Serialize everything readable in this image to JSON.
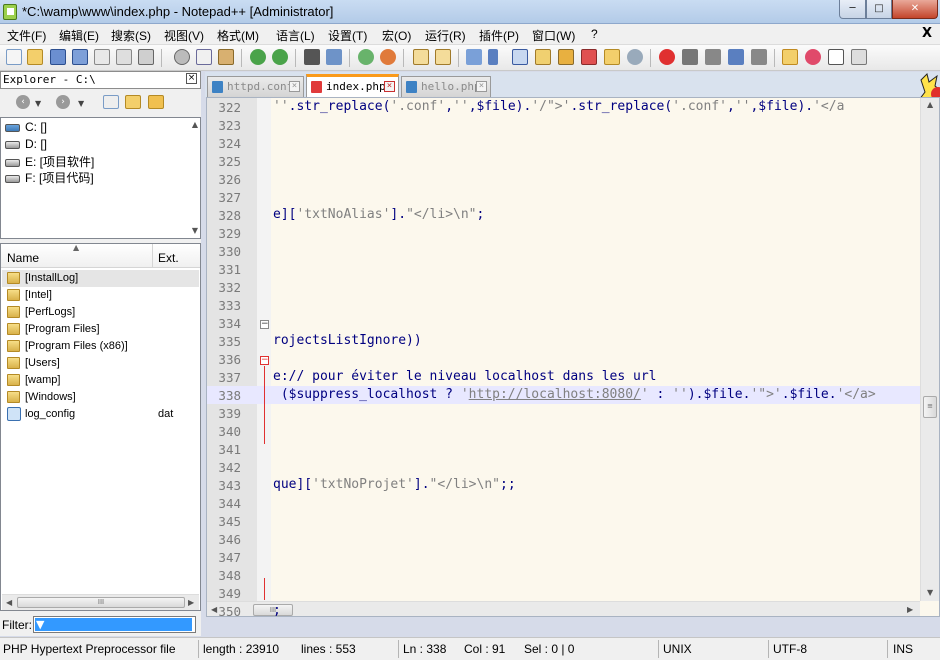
{
  "window": {
    "title": "*C:\\wamp\\www\\index.php - Notepad++ [Administrator]",
    "minimize": "─",
    "maximize": "□",
    "close": "✕"
  },
  "menu": {
    "items": [
      "文件(F)",
      "编辑(E)",
      "搜索(S)",
      "视图(V)",
      "格式(M)",
      "语言(L)",
      "设置(T)",
      "宏(O)",
      "运行(R)",
      "插件(P)",
      "窗口(W)",
      "?"
    ],
    "close": "X"
  },
  "toolbar": {
    "buttons": [
      "new-file-icon",
      "open-file-icon",
      "save-icon",
      "save-all-icon",
      "close-icon",
      "close-all-icon",
      "print-icon",
      "cut-icon",
      "copy-icon",
      "paste-icon",
      "undo-icon",
      "redo-icon",
      "find-icon",
      "replace-icon",
      "zoom-in-icon",
      "zoom-out-icon",
      "sync-v-icon",
      "sync-h-icon",
      "word-wrap-icon",
      "show-all-chars-icon",
      "indent-guide-icon",
      "udl-icon",
      "doc-map-icon",
      "function-list-icon",
      "folder-workspace-icon",
      "monitor-icon",
      "record-macro-icon",
      "stop-record-icon",
      "play-macro-icon",
      "play-multi-icon",
      "save-macro-icon",
      "explorer-toggle-icon",
      "favorites-icon",
      "console-icon",
      "spell-check-icon"
    ]
  },
  "explorer": {
    "title": "Explorer - C:\\",
    "close": "×",
    "drives": [
      {
        "label": "C: []",
        "system": true
      },
      {
        "label": "D: []",
        "system": false
      },
      {
        "label": "E: [项目软件]",
        "system": false
      },
      {
        "label": "F: [项目代码]",
        "system": false
      }
    ],
    "columns": {
      "name": "Name",
      "ext": "Ext."
    },
    "files": [
      {
        "name": "[InstallLog]",
        "ext": "",
        "type": "folder",
        "selected": true
      },
      {
        "name": "[Intel]",
        "ext": "",
        "type": "folder",
        "selected": false
      },
      {
        "name": "[PerfLogs]",
        "ext": "",
        "type": "folder",
        "selected": false
      },
      {
        "name": "[Program Files]",
        "ext": "",
        "type": "folder",
        "selected": false
      },
      {
        "name": "[Program Files (x86)]",
        "ext": "",
        "type": "folder",
        "selected": false
      },
      {
        "name": "[Users]",
        "ext": "",
        "type": "folder",
        "selected": false
      },
      {
        "name": "[wamp]",
        "ext": "",
        "type": "folder",
        "selected": false
      },
      {
        "name": "[Windows]",
        "ext": "",
        "type": "folder",
        "selected": false
      },
      {
        "name": "log_config",
        "ext": "dat",
        "type": "file",
        "selected": false
      }
    ],
    "filter_label": "Filter:",
    "filter_value": "*.*"
  },
  "tabs": [
    {
      "label": "httpd.conf",
      "active": false
    },
    {
      "label": "index.php",
      "active": true
    },
    {
      "label": "hello.php",
      "active": false
    }
  ],
  "editor": {
    "lines": [
      {
        "num": "322",
        "html": "<span class='s'>''</span>.str_replace(<span class='s'>'.conf'</span>,<span class='s'>''</span>,$file).<span class='s'>'/\"&gt;'</span>.str_replace(<span class='s'>'.conf'</span>,<span class='s'>''</span>,$file).<span class='s'>'&lt;/a</span>"
      },
      {
        "num": "323",
        "html": ""
      },
      {
        "num": "324",
        "html": ""
      },
      {
        "num": "325",
        "html": ""
      },
      {
        "num": "326",
        "html": ""
      },
      {
        "num": "327",
        "html": ""
      },
      {
        "num": "328",
        "html": "e][<span class='s'>'txtNoAlias'</span>].<span class='s'>\"&lt;/li&gt;\\n\"</span>;"
      },
      {
        "num": "329",
        "html": ""
      },
      {
        "num": "330",
        "html": ""
      },
      {
        "num": "331",
        "html": ""
      },
      {
        "num": "332",
        "html": ""
      },
      {
        "num": "333",
        "html": ""
      },
      {
        "num": "334",
        "html": ""
      },
      {
        "num": "335",
        "html": "rojectsListIgnore))"
      },
      {
        "num": "336",
        "html": ""
      },
      {
        "num": "337",
        "html": "e:// pour éviter le niveau localhost dans les url"
      },
      {
        "num": "338",
        "html": " ($suppress_localhost ? <span class='s'>'</span><span class='u'>http://localhost:8080/</span><span class='s'>'</span> : <span class='s'>''</span>).$file.<span class='s'>'\"&gt;'</span>.$file.<span class='s'>'&lt;/a&gt;</span>"
      },
      {
        "num": "339",
        "html": ""
      },
      {
        "num": "340",
        "html": ""
      },
      {
        "num": "341",
        "html": ""
      },
      {
        "num": "342",
        "html": ""
      },
      {
        "num": "343",
        "html": "que][<span class='s'>'txtNoProjet'</span>].<span class='s'>\"&lt;/li&gt;\\n\"</span>;;"
      },
      {
        "num": "344",
        "html": ""
      },
      {
        "num": "345",
        "html": ""
      },
      {
        "num": "346",
        "html": ""
      },
      {
        "num": "347",
        "html": ""
      },
      {
        "num": "348",
        "html": ""
      },
      {
        "num": "349",
        "html": ""
      },
      {
        "num": "350",
        "html": ";"
      }
    ]
  },
  "statusbar": {
    "filetype": "PHP Hypertext Preprocessor file",
    "length": "length : 23910",
    "lines": "lines : 553",
    "ln": "Ln : 338",
    "col": "Col : 91",
    "sel": "Sel : 0 | 0",
    "eol": "UNIX",
    "encoding": "UTF-8",
    "mode": "INS"
  },
  "colors": {
    "editor_bg": "#fcf8ed",
    "current_line": "#e8e8ff",
    "code_text": "#000080",
    "string_text": "#808080",
    "active_tab_accent": "#fa9a1a"
  }
}
